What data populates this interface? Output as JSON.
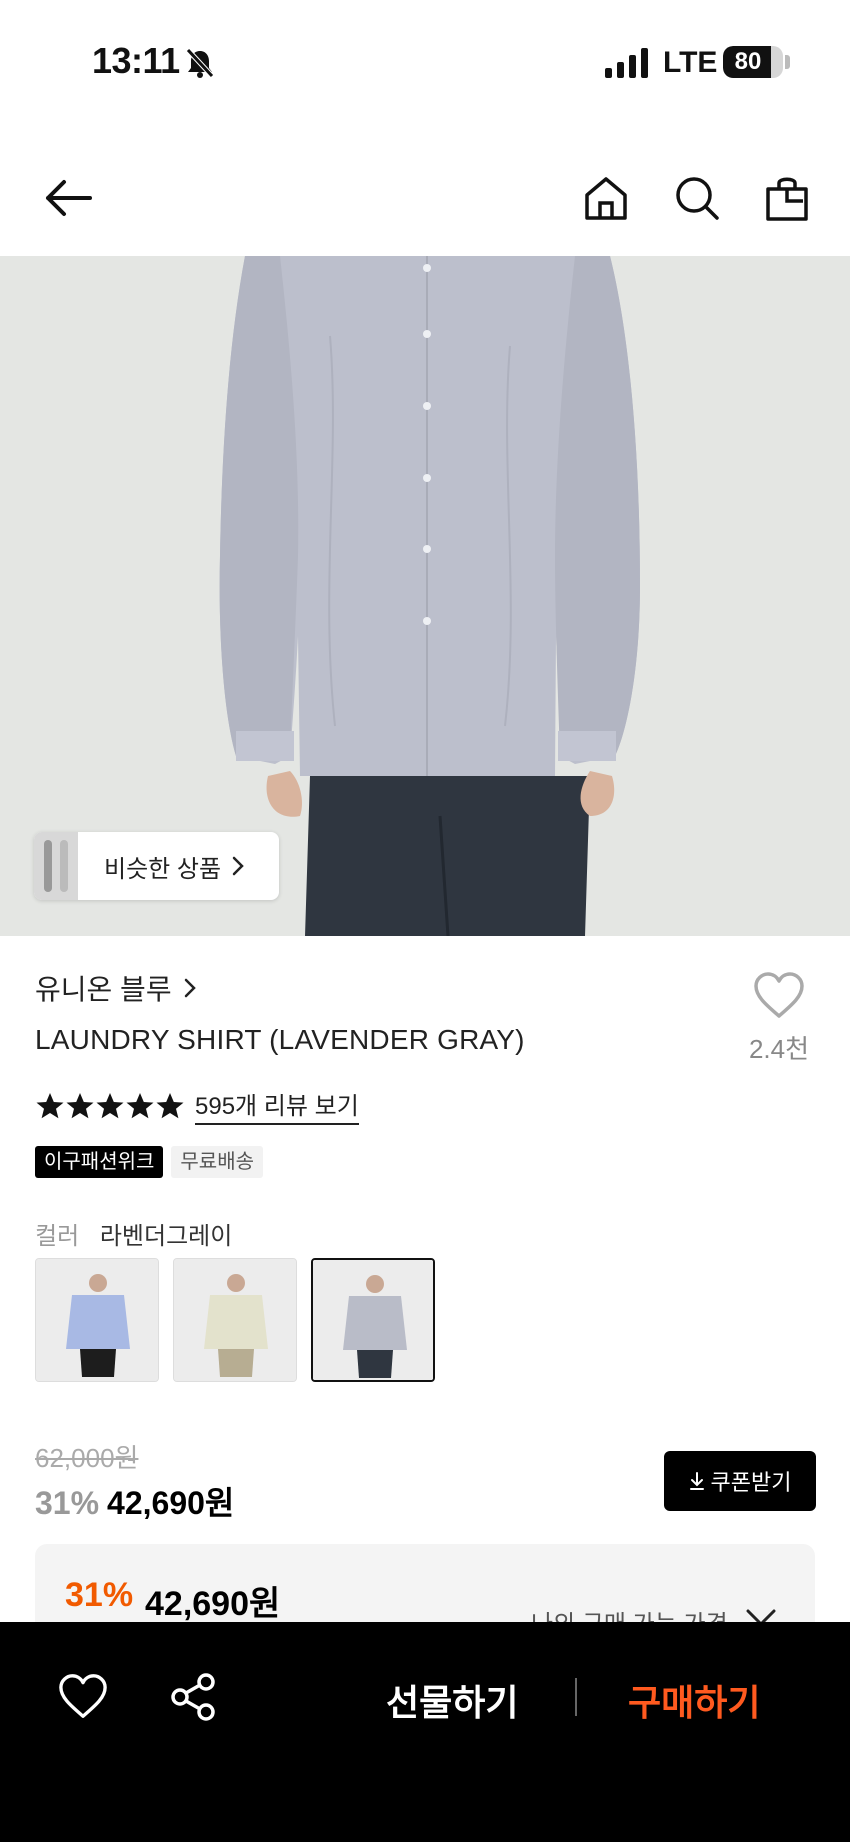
{
  "status_bar": {
    "time": "13:11",
    "network": "LTE",
    "battery": "80",
    "battery_level": 0.8
  },
  "similar": {
    "label": "비슷한 상품"
  },
  "product": {
    "brand": "유니온 블루",
    "title": "LAUNDRY SHIRT (LAVENDER GRAY)",
    "like_count": "2.4천",
    "rating_stars": 5,
    "review_link": "595개 리뷰 보기",
    "badges": [
      "이구패션위크",
      "무료배송"
    ],
    "color_label": "컬러",
    "color_value": "라벤더그레이",
    "swatch_colors": [
      "#a8b9e4",
      "#e3e2cc",
      "#b9bcc8"
    ],
    "selected_swatch": 2
  },
  "price": {
    "original": "62,000원",
    "discount": "31%",
    "sale": "42,690원",
    "coupon": "쿠폰받기",
    "my_discount": "31%",
    "my_price": "42,690원",
    "my_price_label": "나의 구매 가능 가격"
  },
  "bottom_bar": {
    "gift": "선물하기",
    "buy": "구매하기"
  },
  "colors": {
    "accent": "#ff5a1f",
    "discount": "#f15a00"
  }
}
